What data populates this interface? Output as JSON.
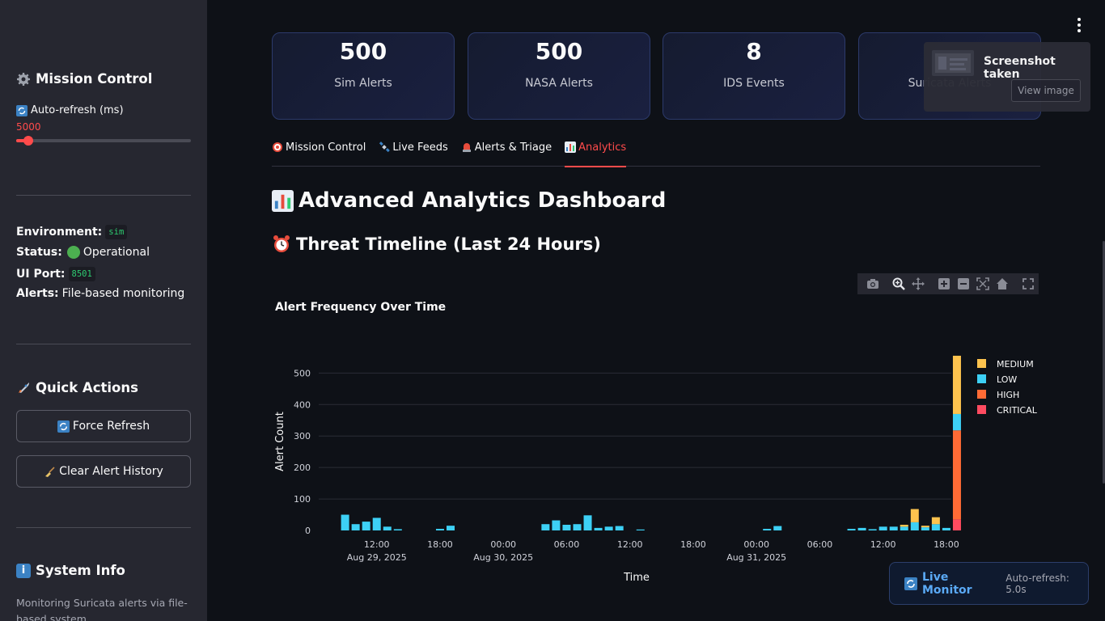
{
  "sidebar": {
    "mission_title": "Mission Control",
    "refresh_label": "Auto-refresh (ms)",
    "refresh_value": "5000",
    "refresh_fraction": 0.07,
    "environment_label": "Environment:",
    "environment_value": "sim",
    "status_label": "Status:",
    "status_value": "Operational",
    "port_label": "UI Port:",
    "port_value": "8501",
    "alerts_label": "Alerts:",
    "alerts_value": "File-based monitoring",
    "quick_actions_title": "Quick Actions",
    "force_refresh_label": "Force Refresh",
    "clear_history_label": "Clear Alert History",
    "system_info_title": "System Info",
    "system_info_text": "Monitoring Suricata alerts via file-based system"
  },
  "metrics": [
    {
      "value": "500",
      "label": "Sim Alerts"
    },
    {
      "value": "500",
      "label": "NASA Alerts"
    },
    {
      "value": "8",
      "label": "IDS Events"
    },
    {
      "value": "",
      "label": "Suricata Alerts"
    }
  ],
  "tabs": [
    {
      "label": "Mission Control",
      "icon": "target-icon"
    },
    {
      "label": "Live Feeds",
      "icon": "satellite-icon"
    },
    {
      "label": "Alerts & Triage",
      "icon": "siren-icon"
    },
    {
      "label": "Analytics",
      "icon": "bar-chart-icon"
    }
  ],
  "active_tab": 3,
  "page": {
    "title": "Advanced Analytics Dashboard",
    "subtitle": "Threat Timeline (Last 24 Hours)"
  },
  "toast": {
    "title": "Screenshot taken",
    "button_label": "View image"
  },
  "live_monitor": {
    "label": "Live Monitor",
    "status": "Auto-refresh: 5.0s"
  },
  "colors": {
    "accent": "#ff4b4b",
    "medium": "#fdc34e",
    "low": "#3dd0f5",
    "high": "#ff6b35",
    "critical": "#ff4b60"
  },
  "chart_data": {
    "type": "bar",
    "title": "Alert Frequency Over Time",
    "xlabel": "Time",
    "ylabel": "Alert Count",
    "ylim": [
      0,
      560
    ],
    "yticks": [
      0,
      100,
      200,
      300,
      400,
      500
    ],
    "xticks": [
      {
        "at": "2025-08-29 12:00",
        "label": "12:00",
        "date": "Aug 29, 2025"
      },
      {
        "at": "2025-08-29 18:00",
        "label": "18:00",
        "date": ""
      },
      {
        "at": "2025-08-30 00:00",
        "label": "00:00",
        "date": "Aug 30, 2025"
      },
      {
        "at": "2025-08-30 06:00",
        "label": "06:00",
        "date": ""
      },
      {
        "at": "2025-08-30 12:00",
        "label": "12:00",
        "date": ""
      },
      {
        "at": "2025-08-30 18:00",
        "label": "18:00",
        "date": ""
      },
      {
        "at": "2025-08-31 00:00",
        "label": "00:00",
        "date": "Aug 31, 2025"
      },
      {
        "at": "2025-08-31 06:00",
        "label": "06:00",
        "date": ""
      },
      {
        "at": "2025-08-31 12:00",
        "label": "12:00",
        "date": ""
      },
      {
        "at": "2025-08-31 18:00",
        "label": "18:00",
        "date": ""
      }
    ],
    "grid": true,
    "stacked": true,
    "legend_position": "top-right",
    "legend": [
      "MEDIUM",
      "LOW",
      "HIGH",
      "CRITICAL"
    ],
    "bars": [
      {
        "x": "2025-08-29 09:00",
        "MEDIUM": 0,
        "LOW": 50,
        "HIGH": 0,
        "CRITICAL": 0
      },
      {
        "x": "2025-08-29 10:00",
        "MEDIUM": 0,
        "LOW": 20,
        "HIGH": 0,
        "CRITICAL": 0
      },
      {
        "x": "2025-08-29 11:00",
        "MEDIUM": 0,
        "LOW": 28,
        "HIGH": 0,
        "CRITICAL": 0
      },
      {
        "x": "2025-08-29 12:00",
        "MEDIUM": 0,
        "LOW": 40,
        "HIGH": 0,
        "CRITICAL": 0
      },
      {
        "x": "2025-08-29 13:00",
        "MEDIUM": 0,
        "LOW": 12,
        "HIGH": 0,
        "CRITICAL": 0
      },
      {
        "x": "2025-08-29 14:00",
        "MEDIUM": 0,
        "LOW": 4,
        "HIGH": 0,
        "CRITICAL": 0
      },
      {
        "x": "2025-08-29 18:00",
        "MEDIUM": 0,
        "LOW": 5,
        "HIGH": 0,
        "CRITICAL": 0
      },
      {
        "x": "2025-08-29 19:00",
        "MEDIUM": 0,
        "LOW": 15,
        "HIGH": 0,
        "CRITICAL": 0
      },
      {
        "x": "2025-08-30 04:00",
        "MEDIUM": 0,
        "LOW": 20,
        "HIGH": 0,
        "CRITICAL": 0
      },
      {
        "x": "2025-08-30 05:00",
        "MEDIUM": 0,
        "LOW": 32,
        "HIGH": 0,
        "CRITICAL": 0
      },
      {
        "x": "2025-08-30 06:00",
        "MEDIUM": 0,
        "LOW": 18,
        "HIGH": 0,
        "CRITICAL": 0
      },
      {
        "x": "2025-08-30 07:00",
        "MEDIUM": 0,
        "LOW": 20,
        "HIGH": 0,
        "CRITICAL": 0
      },
      {
        "x": "2025-08-30 08:00",
        "MEDIUM": 0,
        "LOW": 48,
        "HIGH": 0,
        "CRITICAL": 0
      },
      {
        "x": "2025-08-30 09:00",
        "MEDIUM": 0,
        "LOW": 8,
        "HIGH": 0,
        "CRITICAL": 0
      },
      {
        "x": "2025-08-30 10:00",
        "MEDIUM": 0,
        "LOW": 12,
        "HIGH": 0,
        "CRITICAL": 0
      },
      {
        "x": "2025-08-30 11:00",
        "MEDIUM": 0,
        "LOW": 14,
        "HIGH": 0,
        "CRITICAL": 0
      },
      {
        "x": "2025-08-30 13:00",
        "MEDIUM": 0,
        "LOW": 3,
        "HIGH": 0,
        "CRITICAL": 0
      },
      {
        "x": "2025-08-31 01:00",
        "MEDIUM": 0,
        "LOW": 5,
        "HIGH": 0,
        "CRITICAL": 0
      },
      {
        "x": "2025-08-31 02:00",
        "MEDIUM": 0,
        "LOW": 14,
        "HIGH": 0,
        "CRITICAL": 0
      },
      {
        "x": "2025-08-31 09:00",
        "MEDIUM": 0,
        "LOW": 5,
        "HIGH": 0,
        "CRITICAL": 0
      },
      {
        "x": "2025-08-31 10:00",
        "MEDIUM": 0,
        "LOW": 8,
        "HIGH": 0,
        "CRITICAL": 0
      },
      {
        "x": "2025-08-31 11:00",
        "MEDIUM": 0,
        "LOW": 4,
        "HIGH": 0,
        "CRITICAL": 0
      },
      {
        "x": "2025-08-31 12:00",
        "MEDIUM": 0,
        "LOW": 12,
        "HIGH": 0,
        "CRITICAL": 0
      },
      {
        "x": "2025-08-31 13:00",
        "MEDIUM": 0,
        "LOW": 12,
        "HIGH": 0,
        "CRITICAL": 0
      },
      {
        "x": "2025-08-31 14:00",
        "MEDIUM": 6,
        "LOW": 12,
        "HIGH": 0,
        "CRITICAL": 0
      },
      {
        "x": "2025-08-31 15:00",
        "MEDIUM": 42,
        "LOW": 26,
        "HIGH": 0,
        "CRITICAL": 0
      },
      {
        "x": "2025-08-31 16:00",
        "MEDIUM": 5,
        "LOW": 10,
        "HIGH": 0,
        "CRITICAL": 0
      },
      {
        "x": "2025-08-31 17:00",
        "MEDIUM": 22,
        "LOW": 20,
        "HIGH": 0,
        "CRITICAL": 0
      },
      {
        "x": "2025-08-31 18:00",
        "MEDIUM": 0,
        "LOW": 8,
        "HIGH": 0,
        "CRITICAL": 0
      },
      {
        "x": "2025-08-31 19:00",
        "MEDIUM": 185,
        "LOW": 52,
        "HIGH": 283,
        "CRITICAL": 35
      }
    ]
  }
}
